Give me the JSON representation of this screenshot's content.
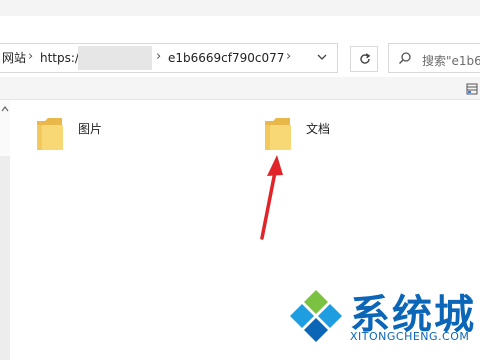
{
  "address_bar": {
    "crumbs": [
      "网站",
      "https://",
      "e1b6669cf790c077"
    ],
    "separator": "›"
  },
  "search": {
    "placeholder": "搜索\"e1b6"
  },
  "folders": [
    {
      "name": "图片"
    },
    {
      "name": "文档"
    }
  ],
  "watermark": {
    "brand": "系统城",
    "site": "XITONGCHENG.COM"
  },
  "colors": {
    "folder_yellow": "#f8d775",
    "arrow_red": "#e0242a",
    "brand_blue": "#0b66b8",
    "brand_green": "#7cc242"
  }
}
